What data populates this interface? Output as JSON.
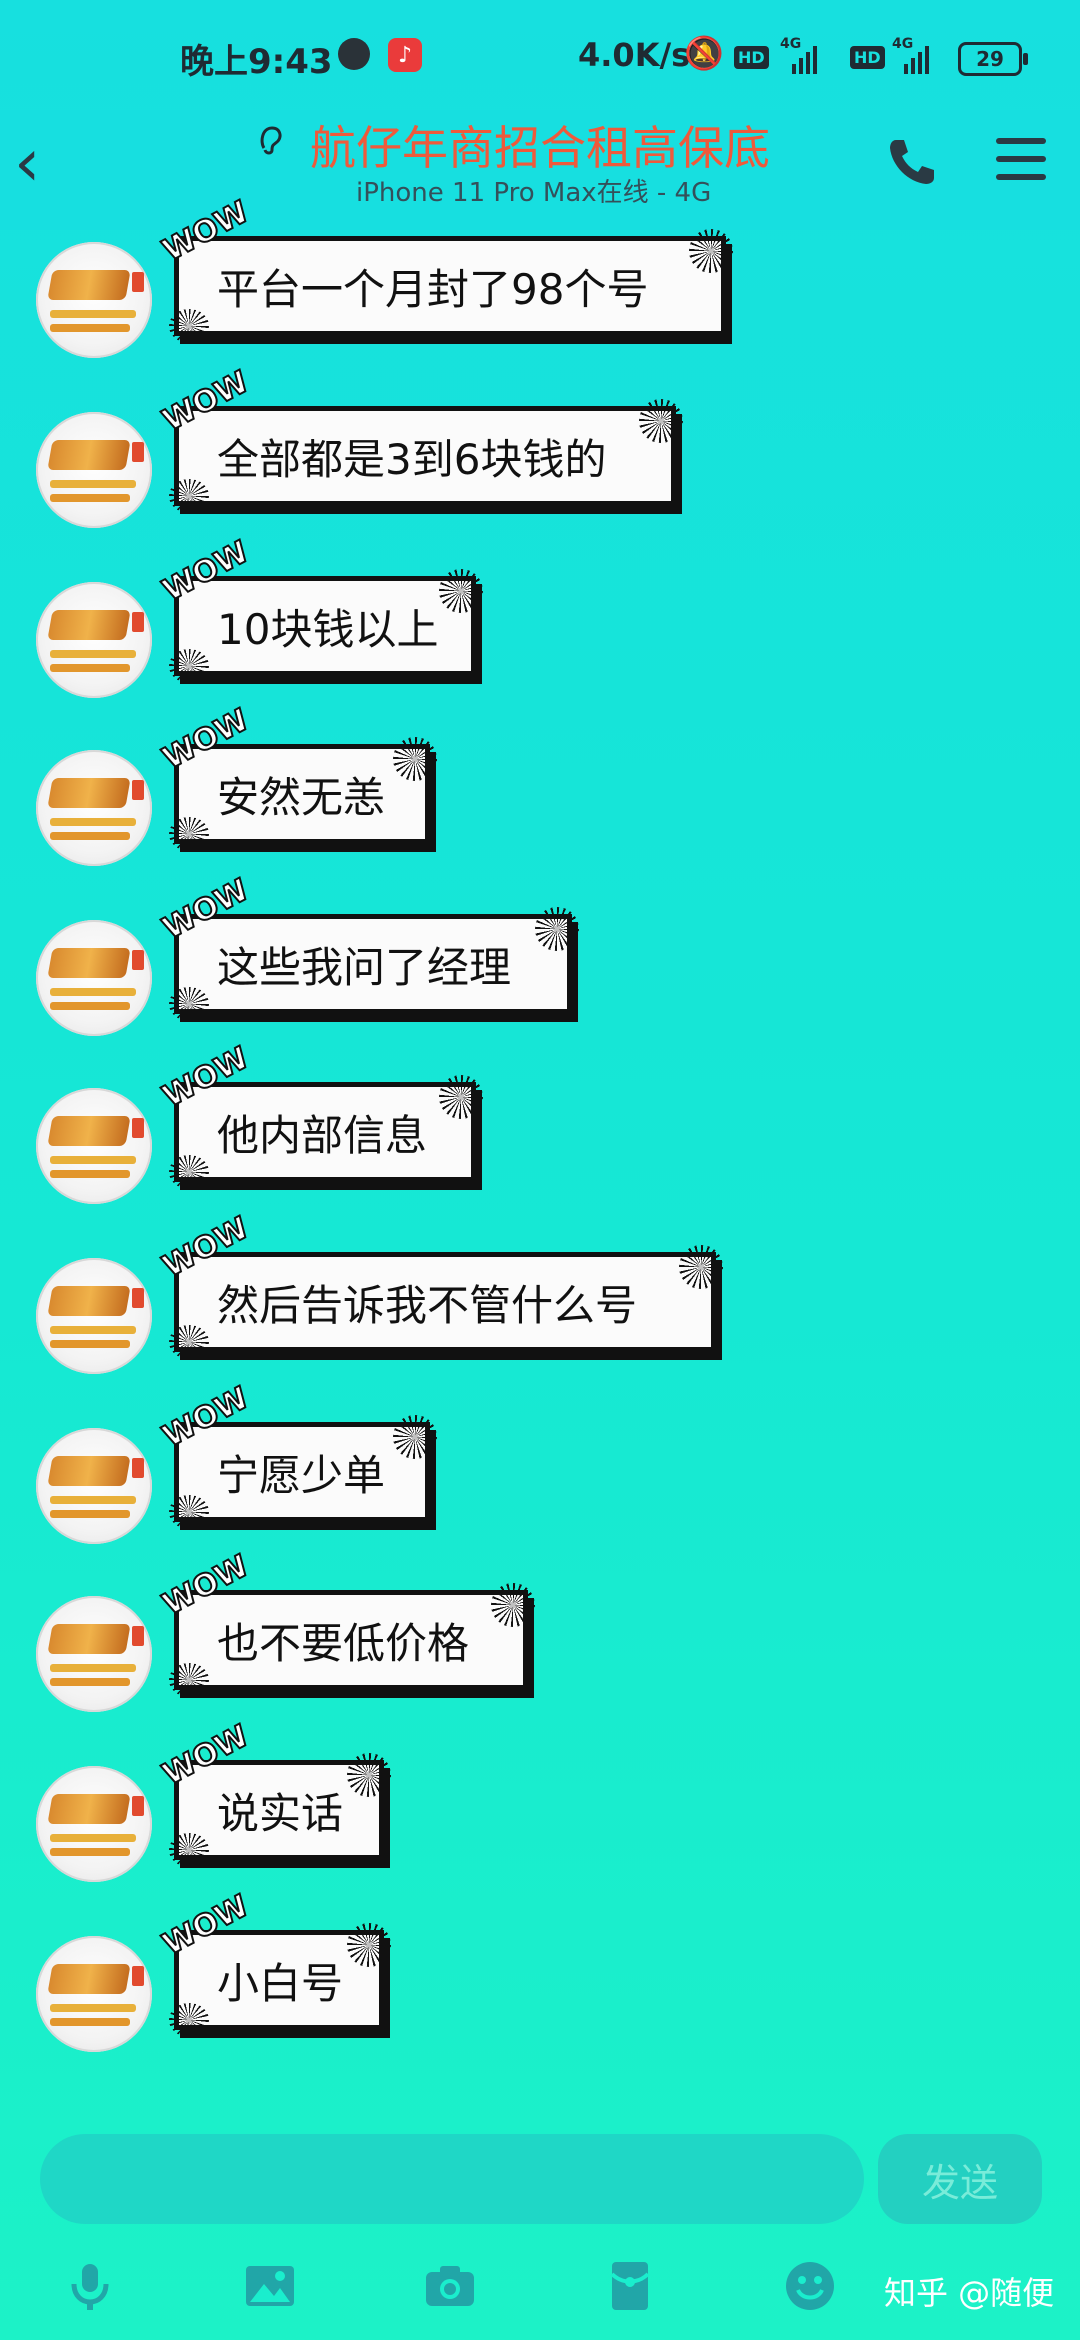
{
  "status_bar": {
    "time": "晚上9:43",
    "speed": "4.0K/s",
    "hd1": "HD",
    "hd2": "HD",
    "net1": "4G",
    "net2": "4G",
    "battery": "29"
  },
  "header": {
    "title": "航仔年商招合租高保底",
    "subtitle": "iPhone 11 Pro Max在线 - 4G"
  },
  "messages": [
    {
      "text": "平台一个月封了98个号"
    },
    {
      "text": "全部都是3到6块钱的"
    },
    {
      "text": "10块钱以上"
    },
    {
      "text": "安然无恙"
    },
    {
      "text": "这些我问了经理"
    },
    {
      "text": "他内部信息"
    },
    {
      "text": "然后告诉我不管什么号"
    },
    {
      "text": "宁愿少单"
    },
    {
      "text": "也不要低价格"
    },
    {
      "text": "说实话"
    },
    {
      "text": "小白号"
    }
  ],
  "bubble_decoration": "WOW",
  "input": {
    "send_label": "发送"
  },
  "watermark": "知乎 @随便",
  "colors": {
    "background": "#17e0df",
    "title": "#ee5a3b",
    "bubble": "#fbfbfb",
    "send_text": "#79ecd9"
  },
  "icons": [
    "back-icon",
    "ear-icon",
    "phone-icon",
    "menu-icon",
    "mic-icon",
    "image-icon",
    "camera-icon",
    "red-packet-icon",
    "emoji-icon"
  ]
}
